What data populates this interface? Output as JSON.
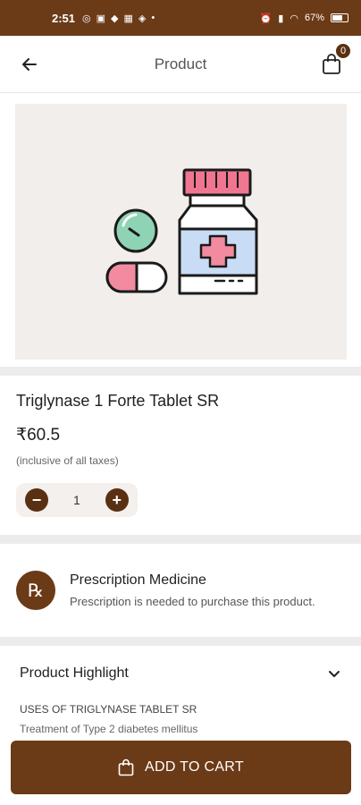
{
  "status_bar": {
    "time": "2:51",
    "battery": "67%"
  },
  "app_bar": {
    "title": "Product",
    "cart_count": "0"
  },
  "product": {
    "name": "Triglynase 1 Forte Tablet SR",
    "price": "₹60.5",
    "tax_note": "(inclusive of all taxes)",
    "quantity": "1",
    "decrement_label": "−",
    "increment_label": "+"
  },
  "prescription": {
    "icon_text": "℞",
    "title": "Prescription Medicine",
    "description": "Prescription is needed to purchase this product."
  },
  "highlight": {
    "title": "Product Highlight",
    "uses_heading": "USES OF TRIGLYNASE TABLET SR",
    "uses_text": "Treatment of Type 2 diabetes mellitus"
  },
  "cta": {
    "label": "ADD TO CART"
  },
  "colors": {
    "brand": "#6b3a17",
    "badge": "#5a3012"
  },
  "icons": [
    "back-arrow-icon",
    "shopping-bag-icon",
    "prescription-rx-icon",
    "chevron-down-icon",
    "medicine-illustration"
  ]
}
